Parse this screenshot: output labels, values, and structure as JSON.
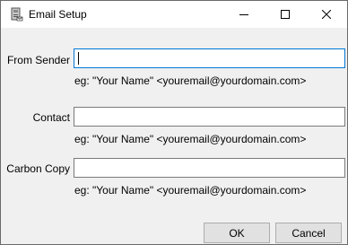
{
  "window": {
    "title": "Email Setup",
    "app_icon": "email-setup-app-icon",
    "controls": [
      "minimize-icon",
      "maximize-icon",
      "close-icon"
    ]
  },
  "form": {
    "from_sender": {
      "label": "From Sender",
      "value": "",
      "hint": "eg: \"Your Name\" <youremail@yourdomain.com>"
    },
    "contact": {
      "label": "Contact",
      "value": "",
      "hint": "eg: \"Your Name\" <youremail@yourdomain.com>"
    },
    "carbon_copy": {
      "label": "Carbon Copy",
      "value": "",
      "hint": "eg: \"Your Name\" <youremail@yourdomain.com>"
    }
  },
  "buttons": {
    "ok": "OK",
    "cancel": "Cancel"
  },
  "colors": {
    "focus_border": "#0078d7",
    "dialog_background": "#f0f0f0",
    "titlebar_background": "#ffffff"
  }
}
